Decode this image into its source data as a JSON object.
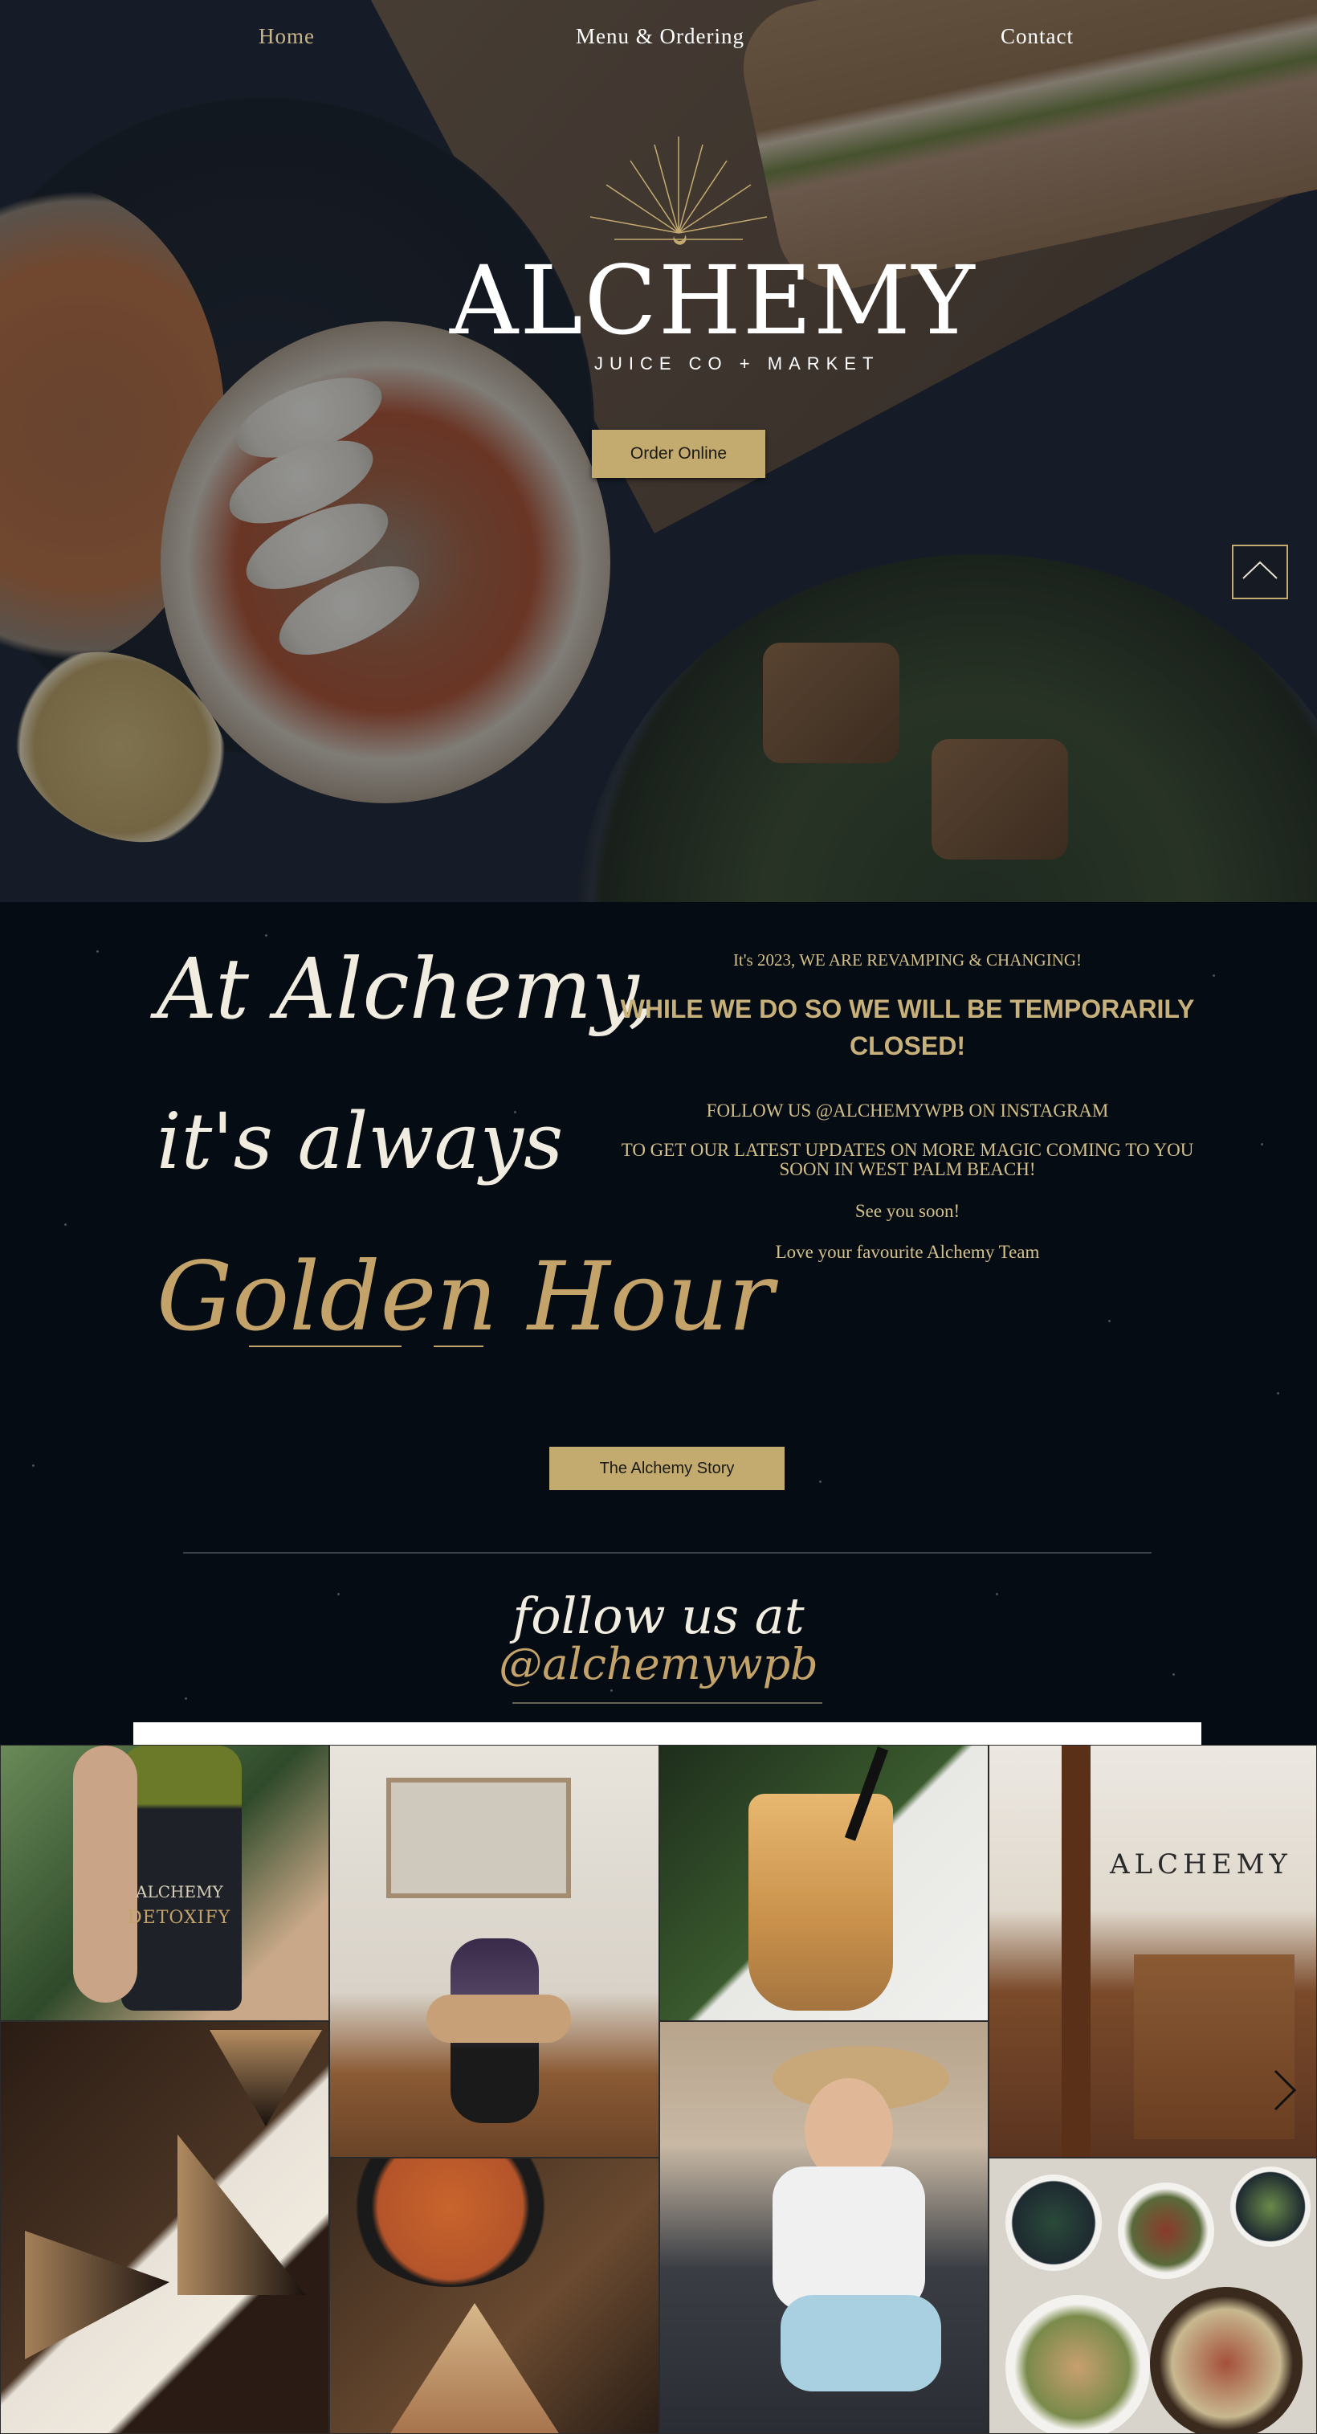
{
  "nav": {
    "items": [
      {
        "label": "Home",
        "active": true
      },
      {
        "label": "Menu & Ordering",
        "active": false
      },
      {
        "label": "Contact",
        "active": false
      }
    ]
  },
  "hero": {
    "logo_word": "ALCHEMY",
    "logo_sub": "JUICE CO + MARKET",
    "order_button": "Order Online"
  },
  "intro": {
    "line1": "At Alchemy,",
    "line2": "it's always",
    "line3": "Golden Hour"
  },
  "notice": {
    "line1": "It's 2023, WE ARE REVAMPING & CHANGING!",
    "line2": "WHILE WE DO SO WE WILL BE TEMPORARILY CLOSED!",
    "line3": "FOLLOW US @ALCHEMYWPB ON INSTAGRAM",
    "line4": "TO GET OUR LATEST UPDATES ON MORE MAGIC COMING TO YOU SOON IN WEST PALM BEACH!",
    "line5": "See you soon!",
    "line6": "Love your favourite Alchemy Team"
  },
  "story_button": "The Alchemy Story",
  "social": {
    "follow": "follow us at",
    "handle": "@alchemywpb"
  },
  "gallery": {
    "bottle_brand": "ALCHEMY",
    "bottle_name": "DETOXIFY",
    "wall_sign": "ALCHEMY"
  },
  "colors": {
    "gold": "#c3ab70",
    "dark": "#060c14",
    "nav_active": "#c9b58a"
  }
}
